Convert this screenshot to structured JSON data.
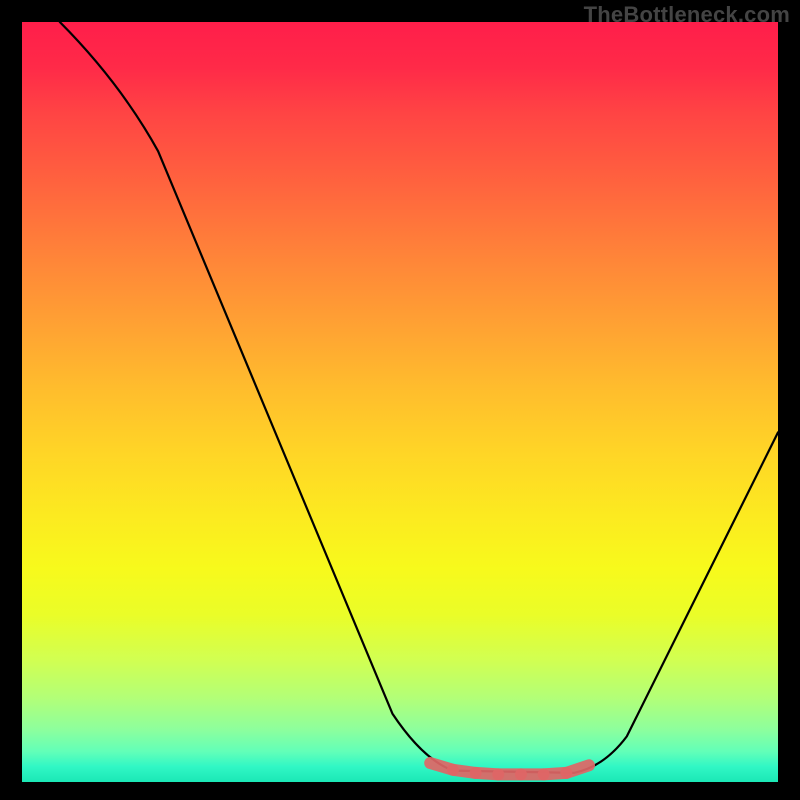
{
  "watermark": "TheBottleneck.com",
  "colors": {
    "curve": "#000000",
    "marker": "#e06666",
    "background": "#000000"
  },
  "chart_data": {
    "type": "line",
    "title": "",
    "xlabel": "",
    "ylabel": "",
    "xlim": [
      0,
      100
    ],
    "ylim": [
      0,
      100
    ],
    "series": [
      {
        "name": "bottleneck-curve",
        "x": [
          0,
          8,
          14,
          20,
          26,
          32,
          38,
          44,
          48,
          52,
          56,
          60,
          63,
          66,
          70,
          74,
          78,
          82,
          86,
          90,
          94,
          98,
          100
        ],
        "y": [
          100,
          94,
          85,
          75,
          65,
          55,
          45,
          35,
          27,
          19,
          12,
          6,
          3,
          1.5,
          1,
          1,
          1.2,
          2.5,
          7,
          15,
          26,
          39,
          46
        ]
      }
    ],
    "markers": {
      "name": "highlight-band",
      "x": [
        54,
        57,
        60,
        63,
        66,
        69,
        72,
        75
      ],
      "y": [
        2.5,
        1.6,
        1.2,
        1.0,
        1.0,
        1.0,
        1.2,
        2.2
      ]
    }
  }
}
